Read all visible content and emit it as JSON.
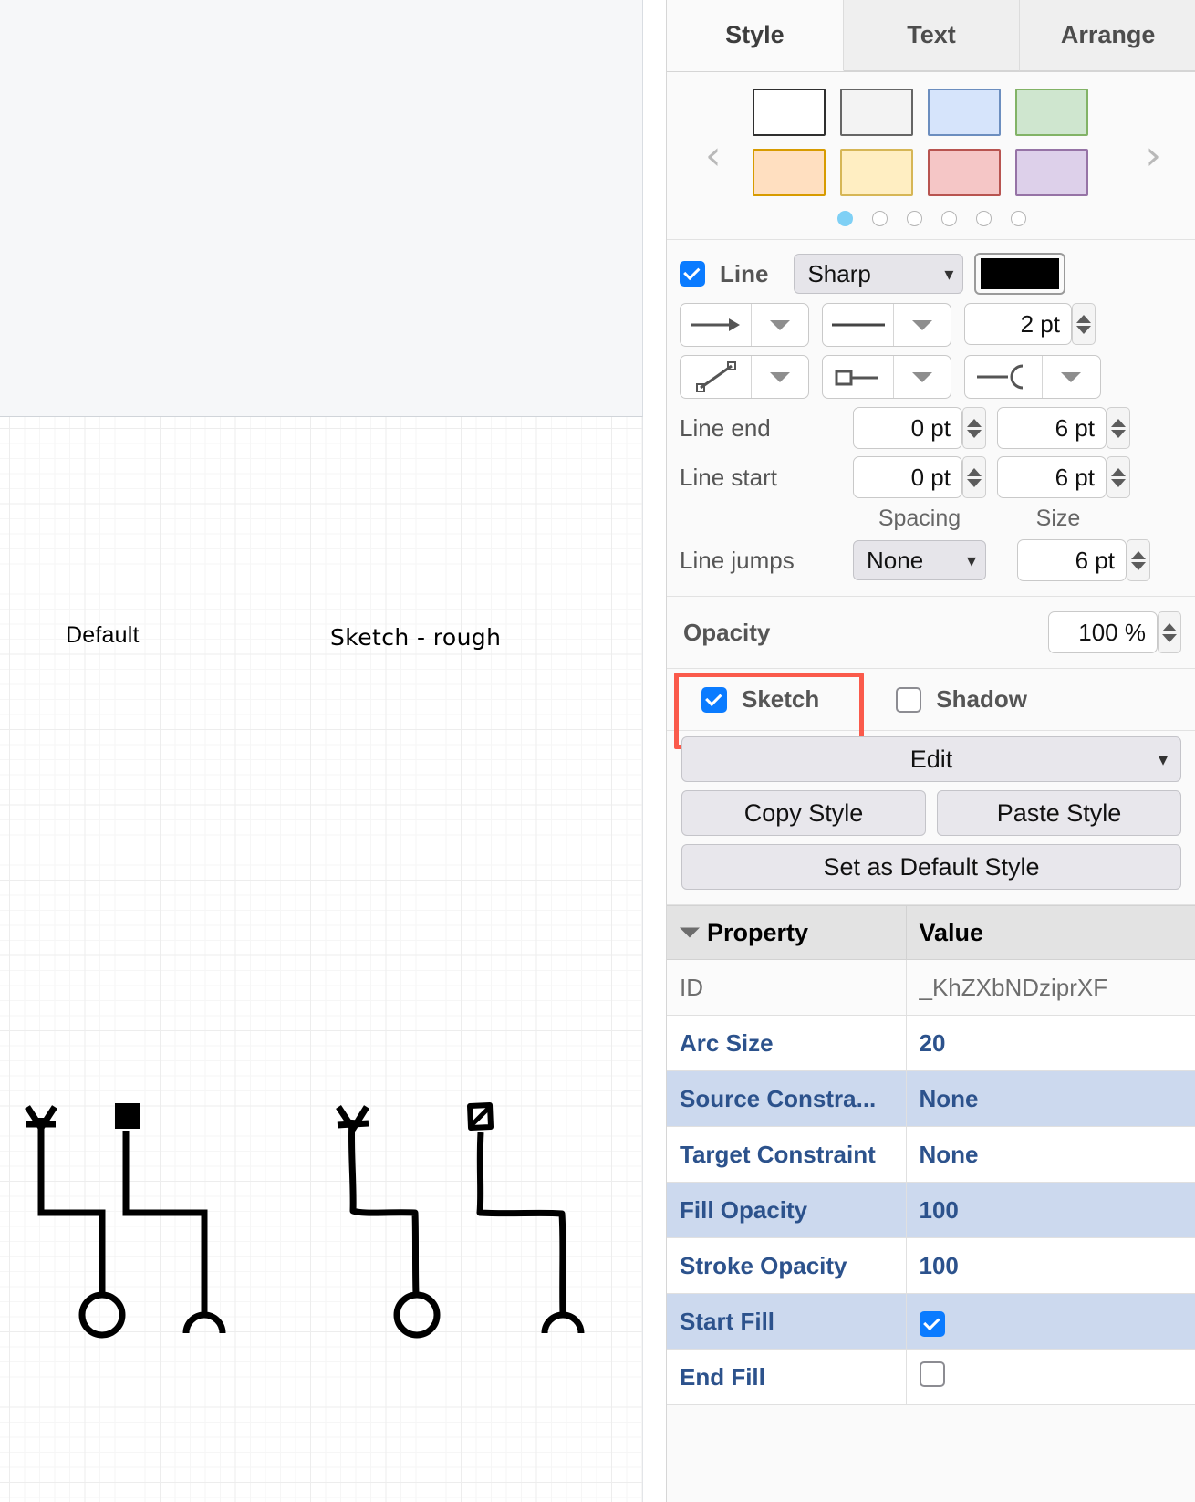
{
  "tabs": [
    {
      "label": "Style",
      "active": true
    },
    {
      "label": "Text",
      "active": false
    },
    {
      "label": "Arrange",
      "active": false
    }
  ],
  "presets": {
    "prev_icon": "chevron-left-icon",
    "next_icon": "chevron-right-icon",
    "row1": [
      {
        "fill": "#ffffff",
        "stroke": "#2f2f2f"
      },
      {
        "fill": "#f3f3f3",
        "stroke": "#666666"
      },
      {
        "fill": "#d6e4fb",
        "stroke": "#6c8ebf"
      },
      {
        "fill": "#cfe6cf",
        "stroke": "#82b366"
      }
    ],
    "row2": [
      {
        "fill": "#ffdfc0",
        "stroke": "#d79b00"
      },
      {
        "fill": "#ffeec2",
        "stroke": "#d6b656"
      },
      {
        "fill": "#f5c6c6",
        "stroke": "#b85450"
      },
      {
        "fill": "#ddd0ea",
        "stroke": "#9673a6"
      }
    ],
    "page_count": 6,
    "active_page": 1
  },
  "line": {
    "checkbox_checked": true,
    "label": "Line",
    "style_value": "Sharp",
    "color": "#000000",
    "arrow_end_icon": "arrow-right-icon",
    "line_style_icon": "solid-line-icon",
    "width_value": "2 pt",
    "waypoint_icon": "diagonal-line-icon",
    "connector_icon": "square-connector-icon",
    "endpoint_icon": "arc-endpoint-icon",
    "line_end_label": "Line end",
    "line_end_spacing": "0 pt",
    "line_end_size": "6 pt",
    "line_start_label": "Line start",
    "line_start_spacing": "0 pt",
    "line_start_size": "6 pt",
    "spacing_caption": "Spacing",
    "size_caption": "Size",
    "line_jumps_label": "Line jumps",
    "line_jumps_value": "None",
    "line_jumps_size": "6 pt"
  },
  "opacity": {
    "label": "Opacity",
    "value": "100 %"
  },
  "effects": {
    "sketch_label": "Sketch",
    "sketch_checked": true,
    "shadow_label": "Shadow",
    "shadow_checked": false,
    "highlight_color": "#fa5a4b"
  },
  "buttons": {
    "edit": "Edit",
    "copy_style": "Copy Style",
    "paste_style": "Paste Style",
    "set_default": "Set as Default Style"
  },
  "property_table": {
    "headers": [
      "Property",
      "Value"
    ],
    "rows": [
      {
        "property": "ID",
        "value": "_KhZXbNDziprXF",
        "kind": "id"
      },
      {
        "property": "Arc Size",
        "value": "20",
        "kind": "norm"
      },
      {
        "property": "Source Constra...",
        "value": "None",
        "kind": "alt"
      },
      {
        "property": "Target Constraint",
        "value": "None",
        "kind": "norm"
      },
      {
        "property": "Fill Opacity",
        "value": "100",
        "kind": "alt"
      },
      {
        "property": "Stroke Opacity",
        "value": "100",
        "kind": "norm"
      },
      {
        "property": "Start Fill",
        "value": "",
        "checkbox": true,
        "kind": "alt"
      },
      {
        "property": "End Fill",
        "value": "",
        "checkbox": false,
        "kind": "norm"
      }
    ]
  },
  "canvas": {
    "label_default": "Default",
    "label_sketch": "Sketch - rough",
    "stroke_color": "#000000"
  }
}
